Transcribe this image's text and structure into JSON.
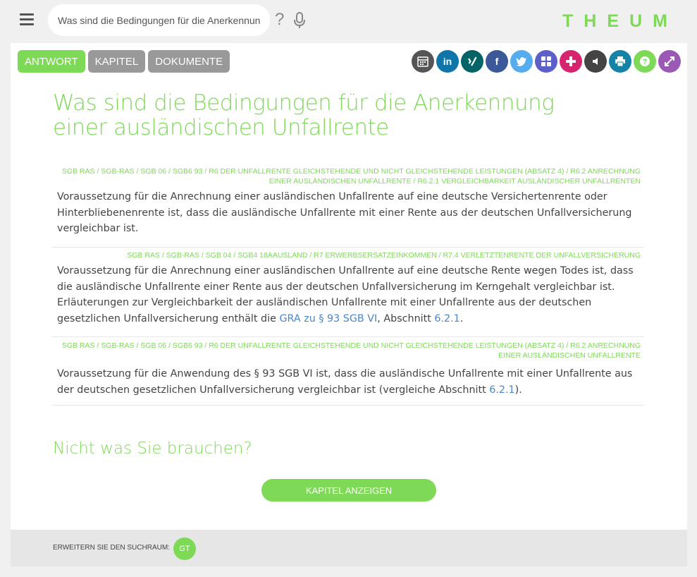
{
  "search": {
    "value": "Was sind die Bedingungen für die Anerkennun",
    "help_glyph": "?"
  },
  "logo": {
    "text": "THEUM",
    "color": "#7ed957"
  },
  "tabs": [
    {
      "label": "ANTWORT",
      "active": true
    },
    {
      "label": "KAPITEL",
      "active": false
    },
    {
      "label": "DOKUMENTE",
      "active": false
    }
  ],
  "share_buttons": [
    {
      "icon": "calendar-icon",
      "color": "#555555"
    },
    {
      "icon": "linkedin-icon",
      "color": "#0e76a8"
    },
    {
      "icon": "xing-icon",
      "color": "#026466"
    },
    {
      "icon": "facebook-icon",
      "color": "#3b5998"
    },
    {
      "icon": "twitter-icon",
      "color": "#55acee"
    },
    {
      "icon": "microsoft-icon",
      "color": "#5b5fc7"
    },
    {
      "icon": "plus-icon",
      "color": "#d6246e"
    },
    {
      "icon": "speaker-icon",
      "color": "#444444"
    },
    {
      "icon": "print-icon",
      "color": "#1483a6"
    },
    {
      "icon": "help-icon",
      "color": "#7ed957"
    },
    {
      "icon": "expand-icon",
      "color": "#9b59b6"
    }
  ],
  "main": {
    "title": "Was sind die Bedingungen für die Anerkennung einer ausländischen Unfallrente",
    "results": [
      {
        "crumb": "SGB RAS / SGB-RAS / SGB 06 / SGB6 93 / R6 DER UNFALLRENTE GLEICHSTEHENDE UND NICHT GLEICHSTEHENDE LEISTUNGEN (ABSATZ 4) / R6.2 ANRECHNUNG EINER AUSLÄNDISCHEN UNFALLRENTE / R6.2.1 VERGLEICHBARKEIT AUSLÄNDISCHER UNFALLRENTEN",
        "text": "Voraussetzung für die Anrechnung einer ausländischen Unfallrente auf eine deutsche Versichertenrente oder Hinterbliebenenrente ist, dass die ausländische Unfallrente mit einer Rente aus der deutschen Unfallversicherung vergleichbar ist."
      },
      {
        "crumb": "SGB RAS / SGB-RAS / SGB 04 / SGB4 18AAUSLAND / R7 ERWERBSERSATZEINKOMMEN / R7.4 VERLETZTENRENTE DER UNFALLVERSICHERUNG",
        "text_before": "Voraussetzung für die Anrechnung einer ausländischen Unfallrente auf eine deutsche Rente wegen Todes ist, dass die ausländische Unfallrente einer Rente aus der deutschen Unfallversicherung im Kerngehalt vergleichbar ist. Erläuterungen zur Vergleichbarkeit der ausländischen Unfallrente mit einer Unfallrente aus der deutschen gesetzlichen Unfallversicherung enthält die ",
        "link1": "GRA zu § 93 SGB VI",
        "text_middle": ", Abschnitt ",
        "link2": "6.2.1",
        "text_after": "."
      },
      {
        "crumb": "SGB RAS / SGB-RAS / SGB 06 / SGB6 93 / R6 DER UNFALLRENTE GLEICHSTEHENDE UND NICHT GLEICHSTEHENDE LEISTUNGEN (ABSATZ 4) / R6.2 ANRECHNUNG EINER AUSLÄNDISCHEN UNFALLRENTE",
        "text_before": "Voraussetzung für die Anwendung des § 93 SGB VI ist, dass die ausländische Unfallrente mit einer Unfallrente aus der deutschen gesetzlichen Unfallversicherung vergleichbar ist (vergleiche Abschnitt ",
        "link": "6.2.1",
        "text_after": ")."
      }
    ],
    "not_needed": "Nicht was Sie brauchen?",
    "chapter_button": "KAPITEL ANZEIGEN"
  },
  "footer": {
    "label": "ERWEITERN SIE DEN SUCHRAUM:",
    "badge": "GT"
  }
}
